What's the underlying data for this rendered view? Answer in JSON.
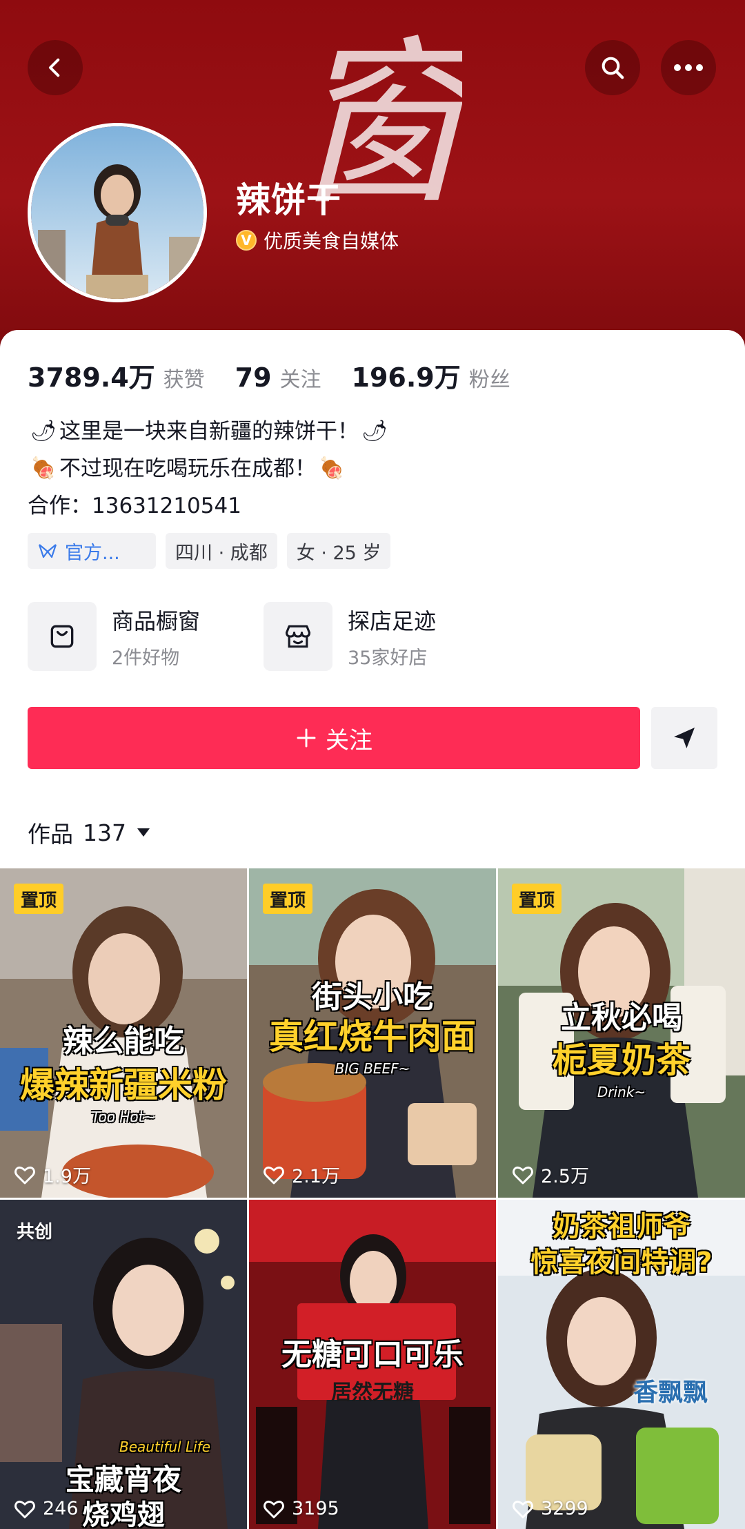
{
  "header": {
    "calligraphy": "窗",
    "name": "辣饼干",
    "verify_badge": "V",
    "verify_label": "优质美食自媒体"
  },
  "stats": [
    {
      "num": "3789.4万",
      "label": "获赞"
    },
    {
      "num": "79",
      "label": "关注"
    },
    {
      "num": "196.9万",
      "label": "粉丝"
    }
  ],
  "bio": {
    "line1": "这里是一块来自新疆的辣饼干！",
    "line2": "不过现在吃喝玩乐在成都！",
    "line3": "合作：13631210541",
    "emoji_pepper": "🌶",
    "emoji_meat": "🍖"
  },
  "tags": {
    "official": "官方...",
    "location": "四川 · 成都",
    "gender_age": "女 · 25 岁"
  },
  "entries": [
    {
      "title": "商品橱窗",
      "sub": "2件好物",
      "icon": "bag-icon"
    },
    {
      "title": "探店足迹",
      "sub": "35家好店",
      "icon": "store-icon"
    }
  ],
  "follow_label": "关注",
  "works": {
    "label": "作品",
    "count": "137"
  },
  "videos": [
    {
      "badge": "置顶",
      "line1": "辣么能吃",
      "line2": "爆辣新疆米粉",
      "line3": "Too Hot~",
      "likes": "1.9万",
      "c1": "#7c6a5a",
      "c2": "#c7b8a6"
    },
    {
      "badge": "置顶",
      "line1": "街头小吃",
      "line2": "真红烧牛肉面",
      "line3": "BIG BEEF~",
      "likes": "2.1万",
      "c1": "#6d5c4c",
      "c2": "#d9c5b3"
    },
    {
      "badge": "置顶",
      "line1": "立秋必喝",
      "line2": "栀夏奶茶",
      "line3": "Drink~",
      "likes": "2.5万",
      "c1": "#5a6a4a",
      "c2": "#cdd6c2"
    },
    {
      "badge": "共创",
      "line1": "Beautiful Life",
      "line2": "宝藏宵夜",
      "line3": "烧鸡翅",
      "likes": "246",
      "c1": "#2a2d3a",
      "c2": "#6a5a5a"
    },
    {
      "badge": "",
      "line1": "",
      "line2": "无糖可口可乐",
      "line3": "居然无糖",
      "likes": "3195",
      "c1": "#4a0c0f",
      "c2": "#b81b22"
    },
    {
      "badge": "",
      "line1": "奶茶祖师爷",
      "line2": "惊喜夜间特调?",
      "line3": "香飘飘",
      "likes": "3299",
      "c1": "#c9d6e2",
      "c2": "#e9eef3"
    }
  ],
  "colors": {
    "accent": "#fe2c55",
    "header_red": "#9d1216",
    "pin_yellow": "#ffcd28"
  }
}
